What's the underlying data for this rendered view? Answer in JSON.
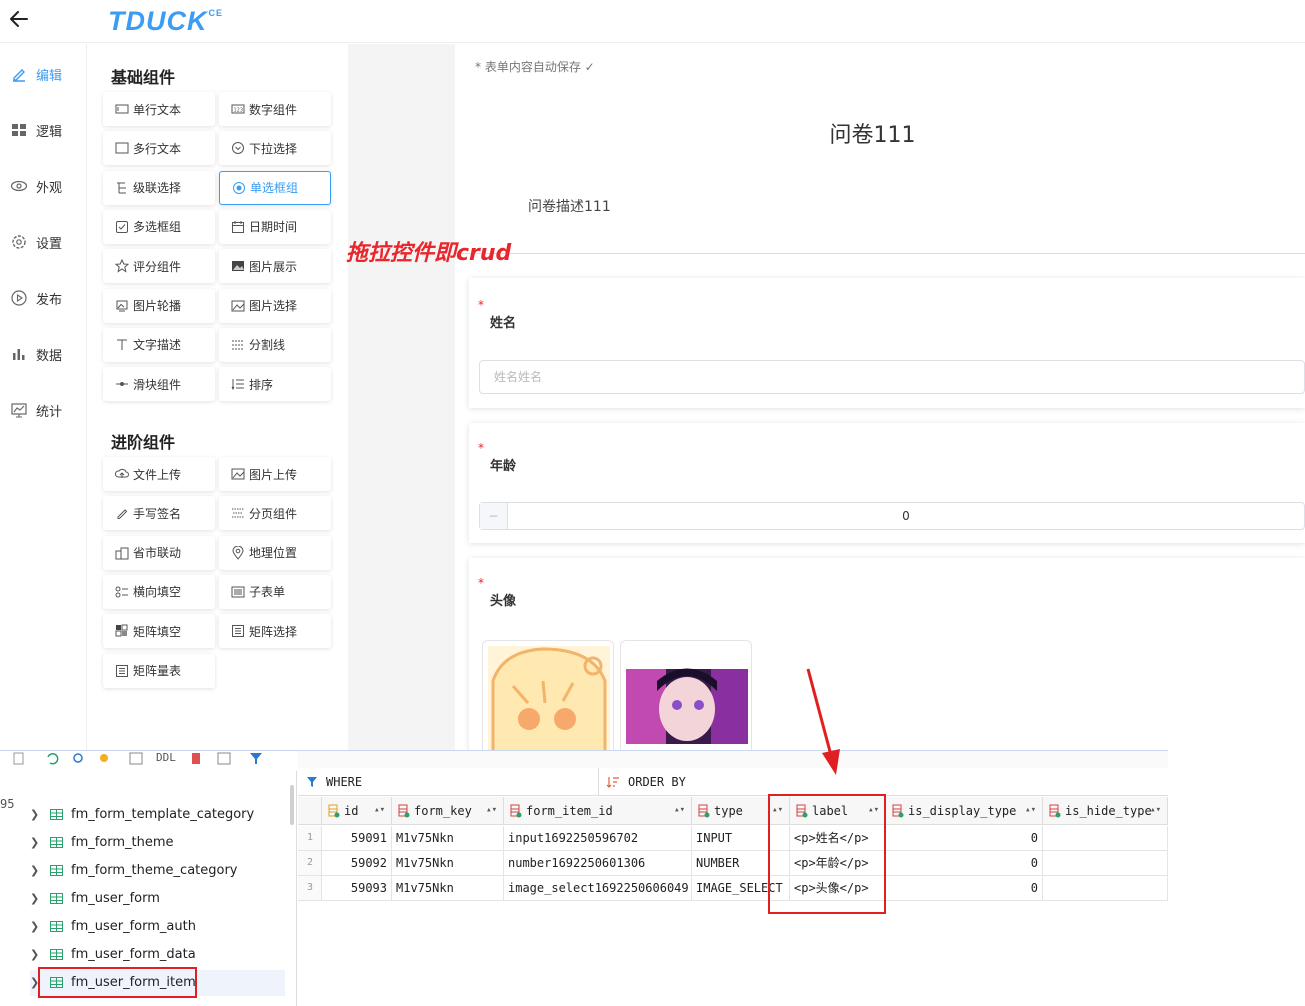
{
  "app": {
    "logo": "TDUCK",
    "logo_sup": "CE"
  },
  "nav": [
    {
      "label": "编辑",
      "icon": "edit-icon",
      "active": true
    },
    {
      "label": "逻辑",
      "icon": "grid-icon"
    },
    {
      "label": "外观",
      "icon": "eye-icon"
    },
    {
      "label": "设置",
      "icon": "gear-icon"
    },
    {
      "label": "发布",
      "icon": "play-icon"
    },
    {
      "label": "数据",
      "icon": "bar-chart-icon"
    },
    {
      "label": "统计",
      "icon": "stats-icon"
    }
  ],
  "palette": {
    "basic_title": "基础组件",
    "basic": [
      {
        "label": "单行文本",
        "icon": "input-icon"
      },
      {
        "label": "数字组件",
        "icon": "number-icon"
      },
      {
        "label": "多行文本",
        "icon": "textarea-icon"
      },
      {
        "label": "下拉选择",
        "icon": "select-icon"
      },
      {
        "label": "级联选择",
        "icon": "cascader-icon"
      },
      {
        "label": "单选框组",
        "icon": "radio-icon",
        "selected": true
      },
      {
        "label": "多选框组",
        "icon": "checkbox-icon"
      },
      {
        "label": "日期时间",
        "icon": "calendar-icon"
      },
      {
        "label": "评分组件",
        "icon": "star-icon"
      },
      {
        "label": "图片展示",
        "icon": "image-icon"
      },
      {
        "label": "图片轮播",
        "icon": "carousel-icon"
      },
      {
        "label": "图片选择",
        "icon": "image-select-icon"
      },
      {
        "label": "文字描述",
        "icon": "text-icon"
      },
      {
        "label": "分割线",
        "icon": "divider-icon"
      },
      {
        "label": "滑块组件",
        "icon": "slider-icon"
      },
      {
        "label": "排序",
        "icon": "sort-icon"
      }
    ],
    "advanced_title": "进阶组件",
    "advanced": [
      {
        "label": "文件上传",
        "icon": "cloud-upload-icon"
      },
      {
        "label": "图片上传",
        "icon": "image-upload-icon"
      },
      {
        "label": "手写签名",
        "icon": "pen-icon"
      },
      {
        "label": "分页组件",
        "icon": "pagination-icon"
      },
      {
        "label": "省市联动",
        "icon": "building-icon"
      },
      {
        "label": "地理位置",
        "icon": "location-icon"
      },
      {
        "label": "横向填空",
        "icon": "fill-blank-icon"
      },
      {
        "label": "子表单",
        "icon": "subform-icon"
      },
      {
        "label": "矩阵填空",
        "icon": "matrix-fill-icon"
      },
      {
        "label": "矩阵选择",
        "icon": "matrix-select-icon"
      },
      {
        "label": "矩阵量表",
        "icon": "matrix-scale-icon"
      }
    ]
  },
  "canvas": {
    "autosave": "* 表单内容自动保存 ✓",
    "title": "问卷111",
    "description": "问卷描述111",
    "annotation": "拖拉控件即crud",
    "questions": {
      "name_label": "姓名",
      "name_placeholder": "姓名姓名",
      "age_label": "年龄",
      "age_minus": "−",
      "age_value": "0",
      "avatar_label": "头像",
      "required_mark": "*"
    }
  },
  "db": {
    "toolbar_ddl": "DDL",
    "side_number": "95",
    "tables": [
      "fm_form_template_category",
      "fm_form_theme",
      "fm_form_theme_category",
      "fm_user_form",
      "fm_user_form_auth",
      "fm_user_form_data",
      "fm_user_form_item"
    ],
    "where": "WHERE",
    "order_by": "ORDER BY",
    "columns": [
      "id",
      "form_key",
      "form_item_id",
      "type",
      "label",
      "is_display_type",
      "is_hide_type"
    ],
    "rows": [
      {
        "n": "1",
        "id": "59091",
        "form_key": "M1v75Nkn",
        "form_item_id": "input1692250596702",
        "type": "INPUT",
        "label": "<p>姓名</p>",
        "is_display_type": "0",
        "is_hide_type": ""
      },
      {
        "n": "2",
        "id": "59092",
        "form_key": "M1v75Nkn",
        "form_item_id": "number1692250601306",
        "type": "NUMBER",
        "label": "<p>年龄</p>",
        "is_display_type": "0",
        "is_hide_type": ""
      },
      {
        "n": "3",
        "id": "59093",
        "form_key": "M1v75Nkn",
        "form_item_id": "image_select1692250606049",
        "type": "IMAGE_SELECT",
        "label": "<p>头像</p>",
        "is_display_type": "0",
        "is_hide_type": ""
      }
    ]
  },
  "colors": {
    "accent": "#3b9cf3",
    "annotation": "#e8262c"
  }
}
